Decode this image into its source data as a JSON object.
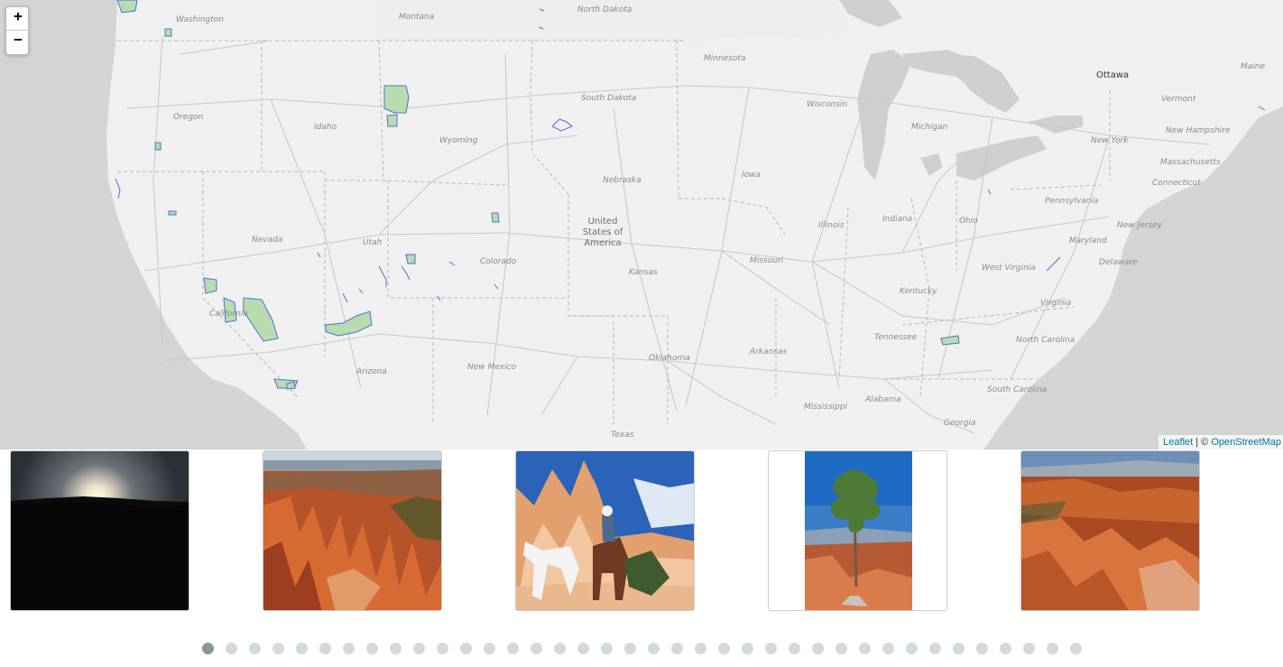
{
  "map": {
    "labels": {
      "washington": "Washington",
      "montana": "Montana",
      "north_dakota": "North Dakota",
      "minnesota": "Minnesota",
      "oregon": "Oregon",
      "idaho": "Idaho",
      "south_dakota": "South Dakota",
      "wyoming": "Wyoming",
      "wisconsin": "Wisconsin",
      "michigan": "Michigan",
      "ottawa": "Ottawa",
      "maine": "Maine",
      "vermont": "Vermont",
      "new_hampshire": "New Hampshire",
      "new_york": "New York",
      "massachusetts": "Massachusetts",
      "connecticut": "Connecticut",
      "nevada": "Nevada",
      "utah": "Utah",
      "nebraska": "Nebraska",
      "iowa": "Iowa",
      "illinois": "Illinois",
      "indiana": "Indiana",
      "ohio": "Ohio",
      "pennsylvania": "Pennsylvania",
      "new_jersey": "New Jersey",
      "maryland": "Maryland",
      "delaware": "Delaware",
      "colorado": "Colorado",
      "kansas": "Kansas",
      "missouri": "Missouri",
      "west_virginia": "West Virginia",
      "kentucky": "Kentucky",
      "virginia": "Virginia",
      "california": "California",
      "arizona": "Arizona",
      "new_mexico": "New Mexico",
      "oklahoma": "Oklahoma",
      "arkansas": "Arkansas",
      "tennessee": "Tennessee",
      "north_carolina": "North Carolina",
      "south_carolina": "South Carolina",
      "mississippi": "Mississippi",
      "alabama": "Alabama",
      "georgia": "Georgia",
      "texas": "Texas",
      "country": "United States of America"
    },
    "zoom_in": "+",
    "zoom_out": "−",
    "attribution": {
      "leaflet": "Leaflet",
      "separator": " | © ",
      "osm": "OpenStreetMap"
    }
  },
  "gallery": {
    "photos": [
      {
        "name": "sunset-photo"
      },
      {
        "name": "canyon-overlook-photo"
      },
      {
        "name": "horseback-rider-photo"
      },
      {
        "name": "lone-pine-tree-photo"
      },
      {
        "name": "amphitheater-hoodoos-photo"
      }
    ],
    "page_count": 38,
    "active_page": 1
  },
  "colors": {
    "park_fill": "#b8dcb0",
    "park_stroke": "#4f6fd6",
    "active_dot": "#869791",
    "inactive_dot": "#d4dada"
  }
}
